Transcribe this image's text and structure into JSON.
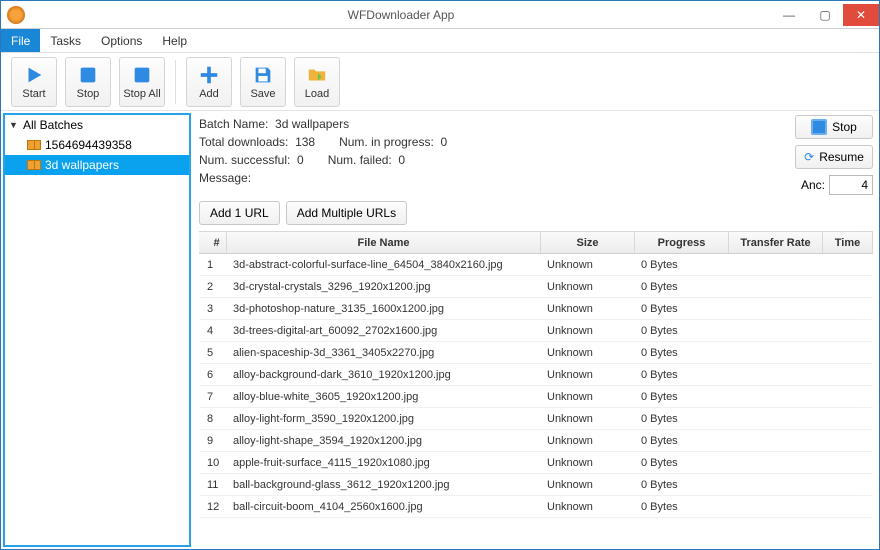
{
  "window": {
    "title": "WFDownloader App"
  },
  "menu": [
    "File",
    "Tasks",
    "Options",
    "Help"
  ],
  "menu_active_index": 0,
  "toolbar": [
    {
      "name": "start",
      "label": "Start"
    },
    {
      "name": "stop",
      "label": "Stop"
    },
    {
      "name": "stopall",
      "label": "Stop All"
    },
    {
      "sep": true
    },
    {
      "name": "add",
      "label": "Add"
    },
    {
      "name": "save",
      "label": "Save"
    },
    {
      "name": "load",
      "label": "Load"
    }
  ],
  "sidebar": {
    "root_label": "All Batches",
    "items": [
      {
        "label": "1564694439358",
        "selected": false
      },
      {
        "label": "3d wallpapers",
        "selected": true
      }
    ]
  },
  "batch": {
    "name_label": "Batch Name:",
    "name_value": "3d wallpapers",
    "total_label": "Total downloads:",
    "total_value": "138",
    "inprog_label": "Num. in progress:",
    "inprog_value": "0",
    "success_label": "Num. successful:",
    "success_value": "0",
    "failed_label": "Num. failed:",
    "failed_value": "0",
    "message_label": "Message:",
    "message_value": ""
  },
  "right": {
    "stop_label": "Stop",
    "resume_label": "Resume",
    "anc_label": "Anc:",
    "anc_value": "4"
  },
  "url_buttons": {
    "add1": "Add 1 URL",
    "addmulti": "Add Multiple URLs"
  },
  "columns": [
    "#",
    "File Name",
    "Size",
    "Progress",
    "Transfer Rate",
    "Time"
  ],
  "rows": [
    {
      "i": "1",
      "name": "3d-abstract-colorful-surface-line_64504_3840x2160.jpg",
      "size": "Unknown",
      "prog": "0 Bytes",
      "rate": "",
      "time": ""
    },
    {
      "i": "2",
      "name": "3d-crystal-crystals_3296_1920x1200.jpg",
      "size": "Unknown",
      "prog": "0 Bytes",
      "rate": "",
      "time": ""
    },
    {
      "i": "3",
      "name": "3d-photoshop-nature_3135_1600x1200.jpg",
      "size": "Unknown",
      "prog": "0 Bytes",
      "rate": "",
      "time": ""
    },
    {
      "i": "4",
      "name": "3d-trees-digital-art_60092_2702x1600.jpg",
      "size": "Unknown",
      "prog": "0 Bytes",
      "rate": "",
      "time": ""
    },
    {
      "i": "5",
      "name": "alien-spaceship-3d_3361_3405x2270.jpg",
      "size": "Unknown",
      "prog": "0 Bytes",
      "rate": "",
      "time": ""
    },
    {
      "i": "6",
      "name": "alloy-background-dark_3610_1920x1200.jpg",
      "size": "Unknown",
      "prog": "0 Bytes",
      "rate": "",
      "time": ""
    },
    {
      "i": "7",
      "name": "alloy-blue-white_3605_1920x1200.jpg",
      "size": "Unknown",
      "prog": "0 Bytes",
      "rate": "",
      "time": ""
    },
    {
      "i": "8",
      "name": "alloy-light-form_3590_1920x1200.jpg",
      "size": "Unknown",
      "prog": "0 Bytes",
      "rate": "",
      "time": ""
    },
    {
      "i": "9",
      "name": "alloy-light-shape_3594_1920x1200.jpg",
      "size": "Unknown",
      "prog": "0 Bytes",
      "rate": "",
      "time": ""
    },
    {
      "i": "10",
      "name": "apple-fruit-surface_4115_1920x1080.jpg",
      "size": "Unknown",
      "prog": "0 Bytes",
      "rate": "",
      "time": ""
    },
    {
      "i": "11",
      "name": "ball-background-glass_3612_1920x1200.jpg",
      "size": "Unknown",
      "prog": "0 Bytes",
      "rate": "",
      "time": ""
    },
    {
      "i": "12",
      "name": "ball-circuit-boom_4104_2560x1600.jpg",
      "size": "Unknown",
      "prog": "0 Bytes",
      "rate": "",
      "time": ""
    }
  ],
  "icons": {
    "start": "play",
    "stop": "square",
    "stopall": "square",
    "add": "plus",
    "save": "floppy",
    "load": "folder",
    "resume": "refresh"
  }
}
